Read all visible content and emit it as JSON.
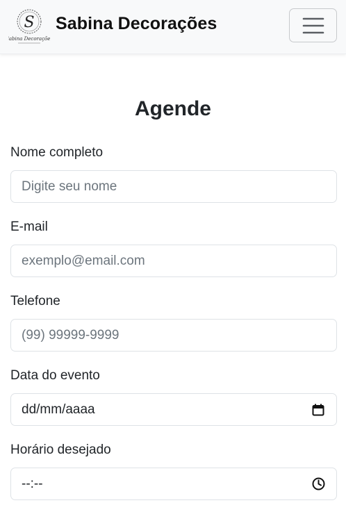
{
  "navbar": {
    "logo_text": "Sabina Decorações",
    "brand": "Sabina Decorações",
    "toggler_icon": "hamburger-menu-icon"
  },
  "form": {
    "title": "Agende",
    "fields": [
      {
        "label": "Nome completo",
        "placeholder": "Digite seu nome"
      },
      {
        "label": "E-mail",
        "placeholder": "exemplo@email.com"
      },
      {
        "label": "Telefone",
        "placeholder": "(99) 99999-9999"
      },
      {
        "label": "Data do evento",
        "value": "dd/mm/aaaa",
        "icon": "calendar-icon"
      },
      {
        "label": "Horário desejado",
        "value": "--:--",
        "icon": "clock-icon"
      }
    ]
  }
}
